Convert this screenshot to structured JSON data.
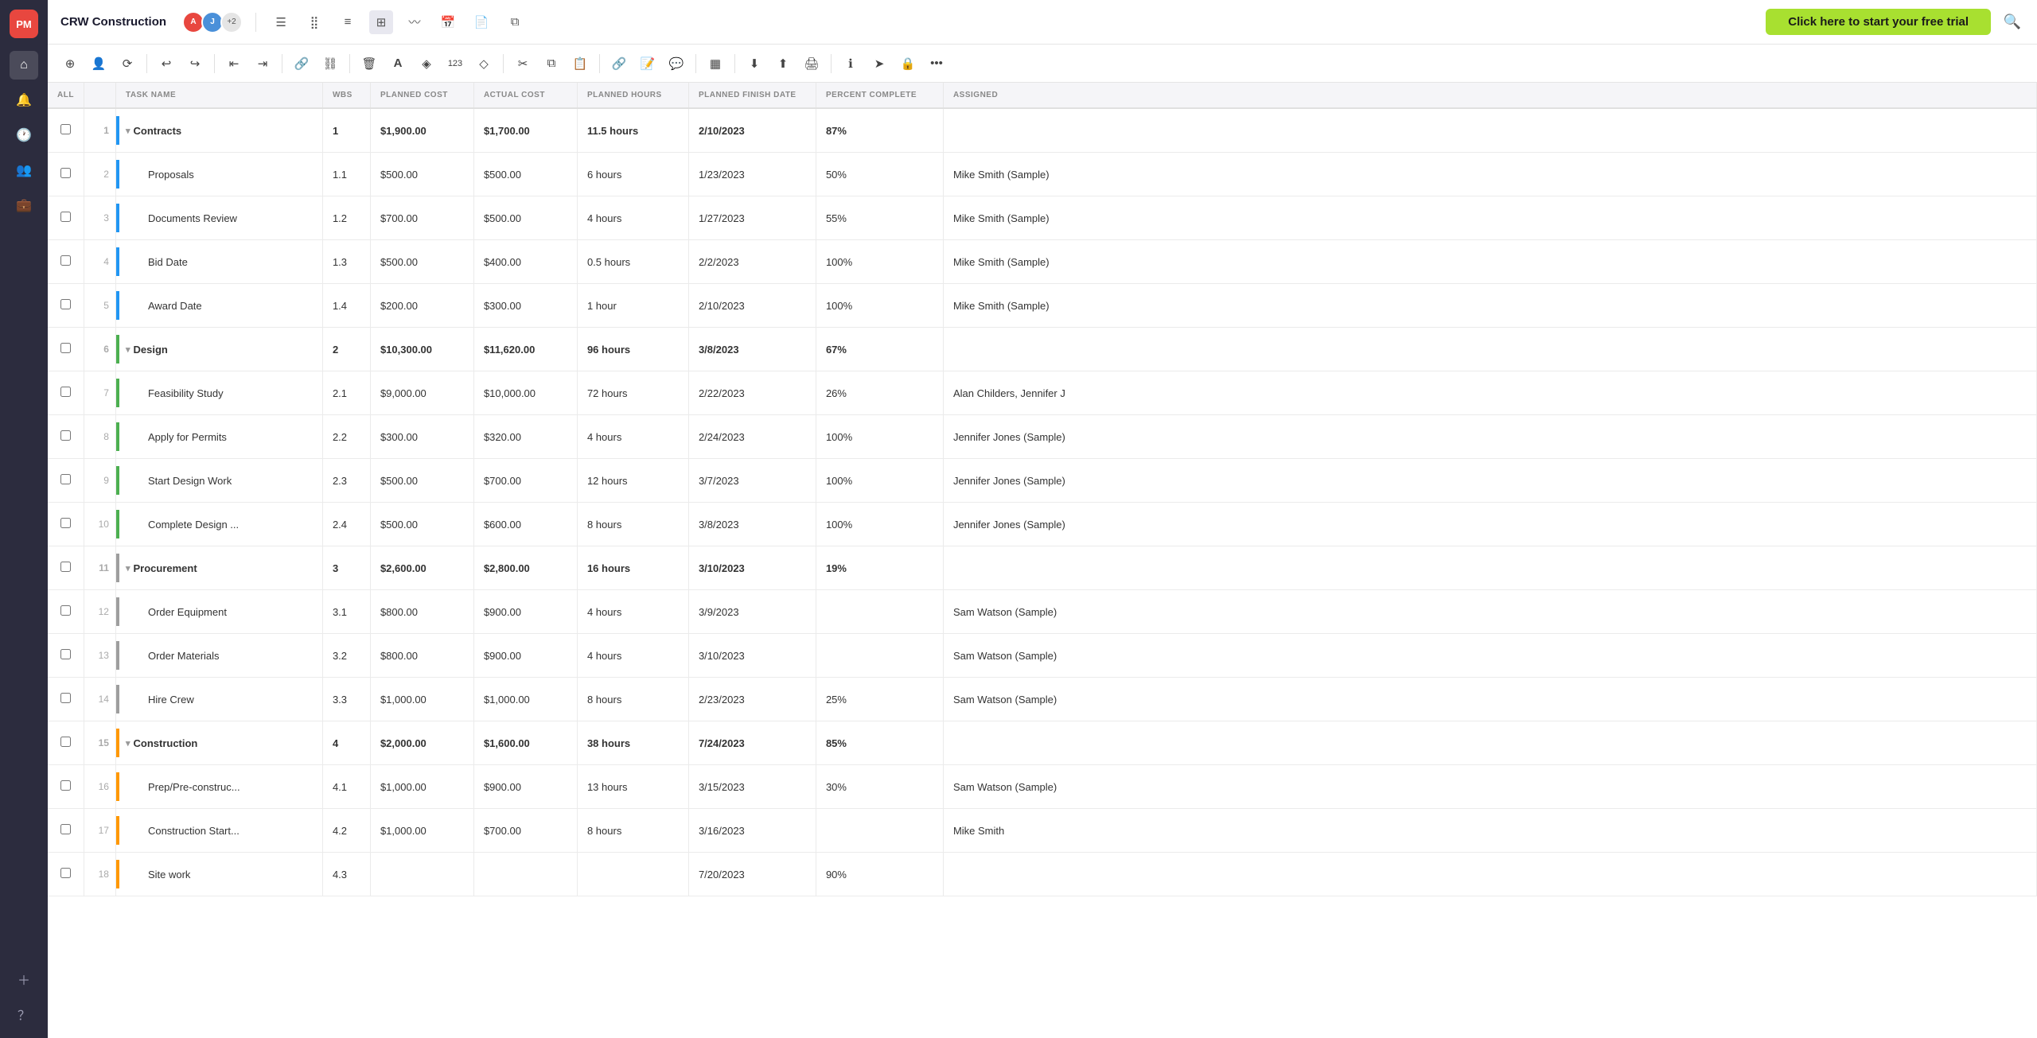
{
  "app": {
    "logo": "PM",
    "project_name": "CRW Construction",
    "trial_btn": "Click here to start your free trial"
  },
  "avatars": [
    {
      "initials": "A",
      "color": "#e8473f"
    },
    {
      "initials": "J",
      "color": "#4a90d9"
    },
    {
      "count": "+2"
    }
  ],
  "toolbar_icons": [
    {
      "name": "add",
      "icon": "⊕"
    },
    {
      "name": "user-add",
      "icon": "👤"
    },
    {
      "name": "refresh",
      "icon": "⟳"
    },
    {
      "name": "undo",
      "icon": "↩"
    },
    {
      "name": "redo",
      "icon": "↪"
    },
    {
      "name": "indent-left",
      "icon": "⇤"
    },
    {
      "name": "indent-right",
      "icon": "⇥"
    },
    {
      "name": "link",
      "icon": "🔗"
    },
    {
      "name": "unlink",
      "icon": "⛓"
    },
    {
      "name": "delete",
      "icon": "🗑"
    },
    {
      "name": "font",
      "icon": "A"
    },
    {
      "name": "highlight",
      "icon": "◈"
    },
    {
      "name": "number",
      "icon": "123"
    },
    {
      "name": "diamond",
      "icon": "◇"
    },
    {
      "name": "cut",
      "icon": "✂"
    },
    {
      "name": "copy",
      "icon": "⧉"
    },
    {
      "name": "paste",
      "icon": "📋"
    },
    {
      "name": "hyperlink",
      "icon": "🔗"
    },
    {
      "name": "notes",
      "icon": "📝"
    },
    {
      "name": "comment",
      "icon": "💬"
    },
    {
      "name": "columns",
      "icon": "▦"
    },
    {
      "name": "download",
      "icon": "⬇"
    },
    {
      "name": "upload",
      "icon": "⬆"
    },
    {
      "name": "print",
      "icon": "🖨"
    },
    {
      "name": "info",
      "icon": "ℹ"
    },
    {
      "name": "send",
      "icon": "➤"
    },
    {
      "name": "lock",
      "icon": "🔒"
    },
    {
      "name": "more",
      "icon": "•••"
    }
  ],
  "columns": [
    {
      "key": "all",
      "label": "ALL"
    },
    {
      "key": "task_name",
      "label": "TASK NAME"
    },
    {
      "key": "wbs",
      "label": "WBS"
    },
    {
      "key": "planned_cost",
      "label": "PLANNED COST"
    },
    {
      "key": "actual_cost",
      "label": "ACTUAL COST"
    },
    {
      "key": "planned_hours",
      "label": "PLANNED HOURS"
    },
    {
      "key": "planned_finish",
      "label": "PLANNED FINISH DATE"
    },
    {
      "key": "percent_complete",
      "label": "PERCENT COMPLETE"
    },
    {
      "key": "assigned",
      "label": "ASSIGNED"
    }
  ],
  "rows": [
    {
      "id": 1,
      "num": 1,
      "level": "parent",
      "indicator": "blue",
      "collapse": true,
      "name": "Contracts",
      "wbs": "1",
      "planned_cost": "$1,900.00",
      "actual_cost": "$1,700.00",
      "planned_hours": "11.5 hours",
      "planned_finish": "2/10/2023",
      "percent_complete": "87%",
      "assigned": ""
    },
    {
      "id": 2,
      "num": 2,
      "level": "child",
      "indicator": "blue",
      "name": "Proposals",
      "wbs": "1.1",
      "planned_cost": "$500.00",
      "actual_cost": "$500.00",
      "planned_hours": "6 hours",
      "planned_finish": "1/23/2023",
      "percent_complete": "50%",
      "assigned": "Mike Smith (Sample)"
    },
    {
      "id": 3,
      "num": 3,
      "level": "child",
      "indicator": "blue",
      "name": "Documents Review",
      "wbs": "1.2",
      "planned_cost": "$700.00",
      "actual_cost": "$500.00",
      "planned_hours": "4 hours",
      "planned_finish": "1/27/2023",
      "percent_complete": "55%",
      "assigned": "Mike Smith (Sample)"
    },
    {
      "id": 4,
      "num": 4,
      "level": "child",
      "indicator": "blue",
      "name": "Bid Date",
      "wbs": "1.3",
      "planned_cost": "$500.00",
      "actual_cost": "$400.00",
      "planned_hours": "0.5 hours",
      "planned_finish": "2/2/2023",
      "percent_complete": "100%",
      "assigned": "Mike Smith (Sample)"
    },
    {
      "id": 5,
      "num": 5,
      "level": "child",
      "indicator": "blue",
      "name": "Award Date",
      "wbs": "1.4",
      "planned_cost": "$200.00",
      "actual_cost": "$300.00",
      "planned_hours": "1 hour",
      "planned_finish": "2/10/2023",
      "percent_complete": "100%",
      "assigned": "Mike Smith (Sample)"
    },
    {
      "id": 6,
      "num": 6,
      "level": "parent",
      "indicator": "green",
      "collapse": true,
      "name": "Design",
      "wbs": "2",
      "planned_cost": "$10,300.00",
      "actual_cost": "$11,620.00",
      "planned_hours": "96 hours",
      "planned_finish": "3/8/2023",
      "percent_complete": "67%",
      "assigned": ""
    },
    {
      "id": 7,
      "num": 7,
      "level": "child",
      "indicator": "green",
      "name": "Feasibility Study",
      "wbs": "2.1",
      "planned_cost": "$9,000.00",
      "actual_cost": "$10,000.00",
      "planned_hours": "72 hours",
      "planned_finish": "2/22/2023",
      "percent_complete": "26%",
      "assigned": "Alan Childers, Jennifer J"
    },
    {
      "id": 8,
      "num": 8,
      "level": "child",
      "indicator": "green",
      "name": "Apply for Permits",
      "wbs": "2.2",
      "planned_cost": "$300.00",
      "actual_cost": "$320.00",
      "planned_hours": "4 hours",
      "planned_finish": "2/24/2023",
      "percent_complete": "100%",
      "assigned": "Jennifer Jones (Sample)"
    },
    {
      "id": 9,
      "num": 9,
      "level": "child",
      "indicator": "green",
      "name": "Start Design Work",
      "wbs": "2.3",
      "planned_cost": "$500.00",
      "actual_cost": "$700.00",
      "planned_hours": "12 hours",
      "planned_finish": "3/7/2023",
      "percent_complete": "100%",
      "assigned": "Jennifer Jones (Sample)"
    },
    {
      "id": 10,
      "num": 10,
      "level": "child",
      "indicator": "green",
      "name": "Complete Design ...",
      "wbs": "2.4",
      "planned_cost": "$500.00",
      "actual_cost": "$600.00",
      "planned_hours": "8 hours",
      "planned_finish": "3/8/2023",
      "percent_complete": "100%",
      "assigned": "Jennifer Jones (Sample)"
    },
    {
      "id": 11,
      "num": 11,
      "level": "parent",
      "indicator": "gray",
      "collapse": true,
      "name": "Procurement",
      "wbs": "3",
      "planned_cost": "$2,600.00",
      "actual_cost": "$2,800.00",
      "planned_hours": "16 hours",
      "planned_finish": "3/10/2023",
      "percent_complete": "19%",
      "assigned": ""
    },
    {
      "id": 12,
      "num": 12,
      "level": "child",
      "indicator": "gray",
      "name": "Order Equipment",
      "wbs": "3.1",
      "planned_cost": "$800.00",
      "actual_cost": "$900.00",
      "planned_hours": "4 hours",
      "planned_finish": "3/9/2023",
      "percent_complete": "",
      "assigned": "Sam Watson (Sample)"
    },
    {
      "id": 13,
      "num": 13,
      "level": "child",
      "indicator": "gray",
      "name": "Order Materials",
      "wbs": "3.2",
      "planned_cost": "$800.00",
      "actual_cost": "$900.00",
      "planned_hours": "4 hours",
      "planned_finish": "3/10/2023",
      "percent_complete": "",
      "assigned": "Sam Watson (Sample)"
    },
    {
      "id": 14,
      "num": 14,
      "level": "child",
      "indicator": "gray",
      "name": "Hire Crew",
      "wbs": "3.3",
      "planned_cost": "$1,000.00",
      "actual_cost": "$1,000.00",
      "planned_hours": "8 hours",
      "planned_finish": "2/23/2023",
      "percent_complete": "25%",
      "assigned": "Sam Watson (Sample)"
    },
    {
      "id": 15,
      "num": 15,
      "level": "parent",
      "indicator": "orange",
      "collapse": true,
      "name": "Construction",
      "wbs": "4",
      "planned_cost": "$2,000.00",
      "actual_cost": "$1,600.00",
      "planned_hours": "38 hours",
      "planned_finish": "7/24/2023",
      "percent_complete": "85%",
      "assigned": ""
    },
    {
      "id": 16,
      "num": 16,
      "level": "child",
      "indicator": "orange",
      "name": "Prep/Pre-construc...",
      "wbs": "4.1",
      "planned_cost": "$1,000.00",
      "actual_cost": "$900.00",
      "planned_hours": "13 hours",
      "planned_finish": "3/15/2023",
      "percent_complete": "30%",
      "assigned": "Sam Watson (Sample)"
    },
    {
      "id": 17,
      "num": 17,
      "level": "child",
      "indicator": "orange",
      "name": "Construction Start...",
      "wbs": "4.2",
      "planned_cost": "$1,000.00",
      "actual_cost": "$700.00",
      "planned_hours": "8 hours",
      "planned_finish": "3/16/2023",
      "percent_complete": "",
      "assigned": "Mike Smith"
    },
    {
      "id": 18,
      "num": 18,
      "level": "child",
      "indicator": "orange",
      "name": "Site work",
      "wbs": "4.3",
      "planned_cost": "",
      "actual_cost": "",
      "planned_hours": "",
      "planned_finish": "7/20/2023",
      "percent_complete": "90%",
      "assigned": ""
    }
  ],
  "nav_icons": [
    {
      "name": "home",
      "icon": "⌂"
    },
    {
      "name": "notifications",
      "icon": "🔔"
    },
    {
      "name": "history",
      "icon": "🕐"
    },
    {
      "name": "people",
      "icon": "👥"
    },
    {
      "name": "briefcase",
      "icon": "💼"
    }
  ]
}
